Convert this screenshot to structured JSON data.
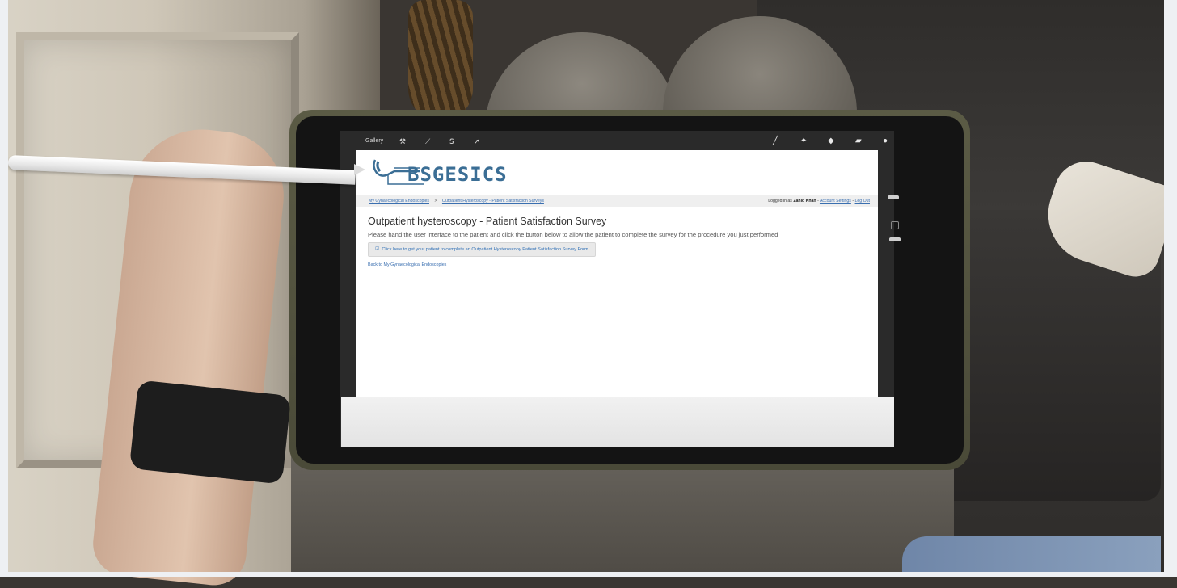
{
  "procreate": {
    "gallery_label": "Gallery"
  },
  "logo": {
    "text": "BSGESICS"
  },
  "breadcrumb": {
    "item1": "My Gynaecological Endoscopies",
    "separator": ">",
    "item2": "Outpatient Hysteroscopy - Patient Satisfaction Surveys"
  },
  "user_bar": {
    "logged_in_prefix": "Logged in as",
    "user_name": "Zahid Khan",
    "dash1": "-",
    "account_settings": "Account Settings",
    "dash2": "-",
    "log_out": "Log Out"
  },
  "main": {
    "title": "Outpatient hysteroscopy - Patient Satisfaction Survey",
    "instructions": "Please hand the user interface to the patient and click the button below to allow the patient to complete the survey for the procedure you just performed",
    "survey_button_label": "Click here to get your patient to complete an Outpatient Hysteroscopy Patient Satisfaction Survey Form",
    "back_link": "Back to My Gynaecological Endoscopies"
  },
  "colors": {
    "brand": "#3b6e95",
    "link": "#3a6fb0",
    "navbar_bg": "#efefef"
  }
}
